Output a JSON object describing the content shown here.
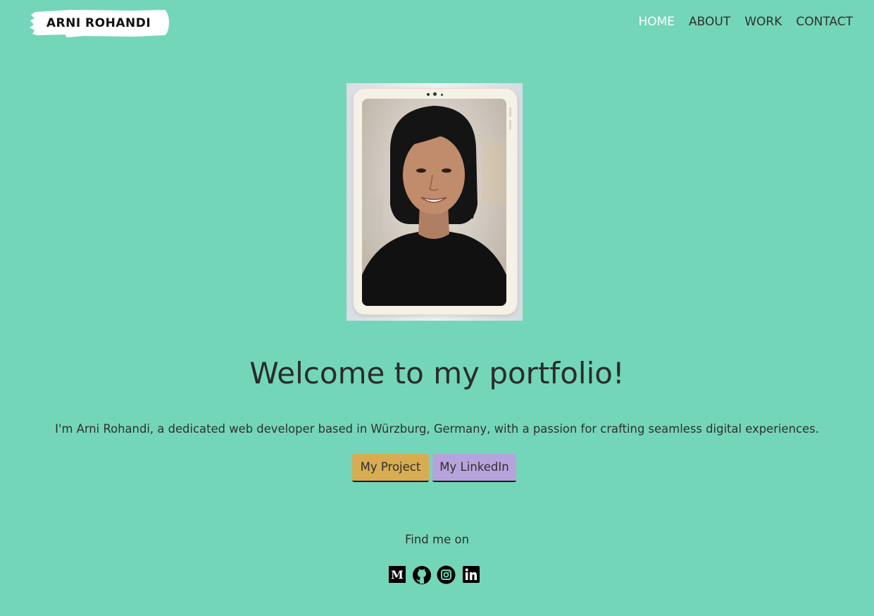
{
  "header": {
    "logo_text": "ARNI ROHANDI",
    "nav": [
      {
        "label": "HOME",
        "active": true
      },
      {
        "label": "ABOUT",
        "active": false
      },
      {
        "label": "WORK",
        "active": false
      },
      {
        "label": "CONTACT",
        "active": false
      }
    ]
  },
  "hero": {
    "title": "Welcome to my portfolio!",
    "intro": "I'm Arni Rohandi, a dedicated web developer based in Würzburg, Germany, with a passion for crafting seamless digital experiences.",
    "project_button": "My Project",
    "linkedin_button": "My LinkedIn"
  },
  "social": {
    "heading": "Find me on",
    "icons": [
      "medium-icon",
      "github-icon",
      "instagram-icon",
      "linkedin-icon"
    ]
  },
  "colors": {
    "background": "#74d6b9",
    "nav_active": "#ffffff",
    "project_button": "#d8ad52",
    "linkedin_button": "#b7a3dc"
  }
}
